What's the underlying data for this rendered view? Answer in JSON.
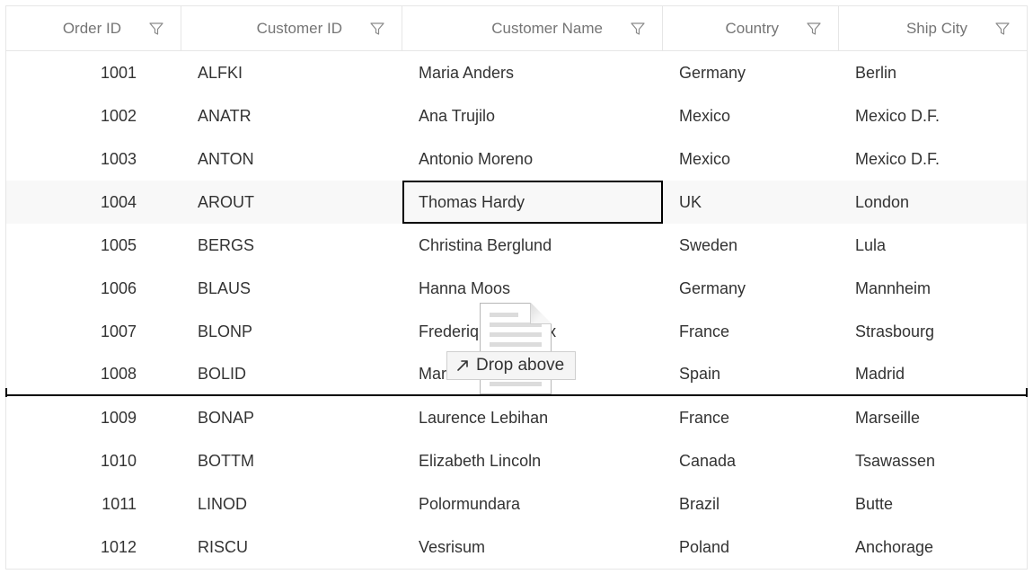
{
  "columns": [
    {
      "label": "Order ID"
    },
    {
      "label": "Customer ID"
    },
    {
      "label": "Customer Name"
    },
    {
      "label": "Country"
    },
    {
      "label": "Ship City"
    }
  ],
  "rows": [
    {
      "order_id": "1001",
      "customer_id": "ALFKI",
      "customer_name": "Maria Anders",
      "country": "Germany",
      "ship_city": "Berlin"
    },
    {
      "order_id": "1002",
      "customer_id": "ANATR",
      "customer_name": "Ana Trujilo",
      "country": "Mexico",
      "ship_city": "Mexico D.F."
    },
    {
      "order_id": "1003",
      "customer_id": "ANTON",
      "customer_name": "Antonio Moreno",
      "country": "Mexico",
      "ship_city": "Mexico D.F."
    },
    {
      "order_id": "1004",
      "customer_id": "AROUT",
      "customer_name": "Thomas Hardy",
      "country": "UK",
      "ship_city": "London"
    },
    {
      "order_id": "1005",
      "customer_id": "BERGS",
      "customer_name": "Christina Berglund",
      "country": "Sweden",
      "ship_city": "Lula"
    },
    {
      "order_id": "1006",
      "customer_id": "BLAUS",
      "customer_name": "Hanna Moos",
      "country": "Germany",
      "ship_city": "Mannheim"
    },
    {
      "order_id": "1007",
      "customer_id": "BLONP",
      "customer_name": "Frederique Citeaux",
      "country": "France",
      "ship_city": "Strasbourg"
    },
    {
      "order_id": "1008",
      "customer_id": "BOLID",
      "customer_name": "Martin Sommer",
      "country": "Spain",
      "ship_city": "Madrid"
    },
    {
      "order_id": "1009",
      "customer_id": "BONAP",
      "customer_name": "Laurence Lebihan",
      "country": "France",
      "ship_city": "Marseille"
    },
    {
      "order_id": "1010",
      "customer_id": "BOTTM",
      "customer_name": "Elizabeth Lincoln",
      "country": "Canada",
      "ship_city": "Tsawassen"
    },
    {
      "order_id": "1011",
      "customer_id": "LINOD",
      "customer_name": "Polormundara",
      "country": "Brazil",
      "ship_city": "Butte"
    },
    {
      "order_id": "1012",
      "customer_id": "RISCU",
      "customer_name": "Vesrisum",
      "country": "Poland",
      "ship_city": "Anchorage"
    }
  ],
  "drag": {
    "label": "Drop above"
  },
  "selected_row_index": 3,
  "selected_cell_col": 2,
  "drop_line_after_row_index": 7
}
